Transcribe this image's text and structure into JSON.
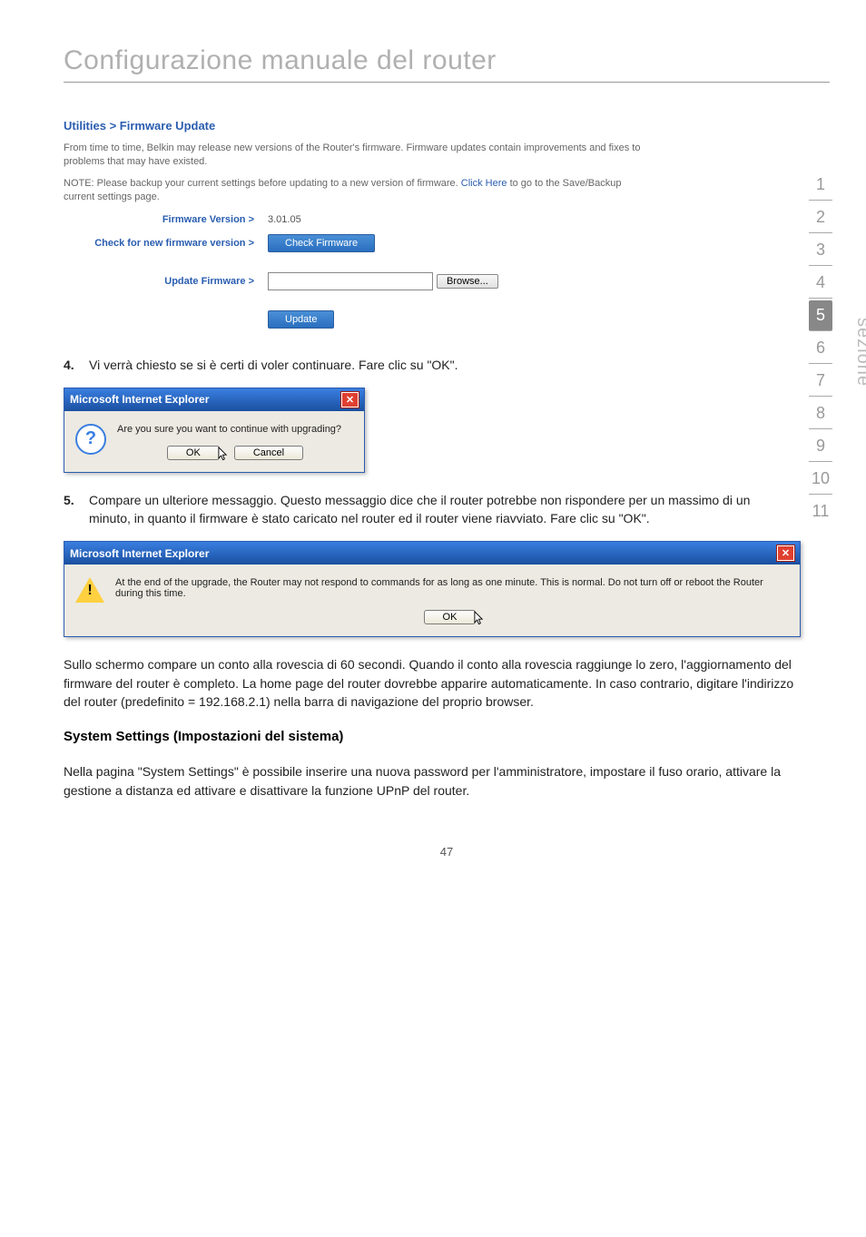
{
  "title": "Configurazione manuale del router",
  "sidebar": {
    "label": "sezione",
    "items": [
      "1",
      "2",
      "3",
      "4",
      "5",
      "6",
      "7",
      "8",
      "9",
      "10",
      "11"
    ],
    "active_index": 4
  },
  "util": {
    "breadcrumb": "Utilities > Firmware Update",
    "intro": "From time to time, Belkin may release new versions of the Router's firmware. Firmware updates contain improvements and fixes to problems that may have existed.",
    "note_pre": "NOTE: Please backup your current settings before updating to a new version of firmware. ",
    "note_link": "Click Here",
    "note_post": " to go to the Save/Backup current settings page.",
    "fw_label": "Firmware Version >",
    "fw_value": "3.01.05",
    "check_label": "Check for new firmware version >",
    "check_btn": "Check Firmware",
    "update_label": "Update Firmware >",
    "browse_btn": "Browse...",
    "update_btn": "Update"
  },
  "step4": {
    "num": "4.",
    "text": "Vi verrà chiesto se si è certi di voler continuare. Fare clic su \"OK\"."
  },
  "dlg1": {
    "title": "Microsoft Internet Explorer",
    "msg": "Are you sure you want to continue with upgrading?",
    "ok": "OK",
    "cancel": "Cancel"
  },
  "step5": {
    "num": "5.",
    "text": "Compare un ulteriore messaggio. Questo messaggio dice che il router potrebbe non rispondere per un massimo di un minuto, in quanto il firmware è stato caricato nel router ed il router viene riavviato. Fare clic su \"OK\"."
  },
  "dlg2": {
    "title": "Microsoft Internet Explorer",
    "msg": "At the end of the upgrade, the Router may not respond to commands for as long as one minute. This is normal. Do not turn off or reboot the Router during this time.",
    "ok": "OK"
  },
  "para": "Sullo schermo compare un conto alla rovescia di 60 secondi. Quando il conto alla rovescia raggiunge lo zero, l'aggiornamento del firmware del router è completo. La home page del router dovrebbe apparire automaticamente. In caso contrario, digitare l'indirizzo del router (predefinito = 192.168.2.1) nella barra di navigazione del proprio browser.",
  "subhead": "System Settings (Impostazioni del sistema)",
  "para2": "Nella pagina \"System Settings\" è possibile inserire una nuova password per l'amministratore, impostare il fuso orario, attivare la gestione a distanza ed attivare e disattivare la funzione UPnP del router.",
  "pagenum": "47"
}
